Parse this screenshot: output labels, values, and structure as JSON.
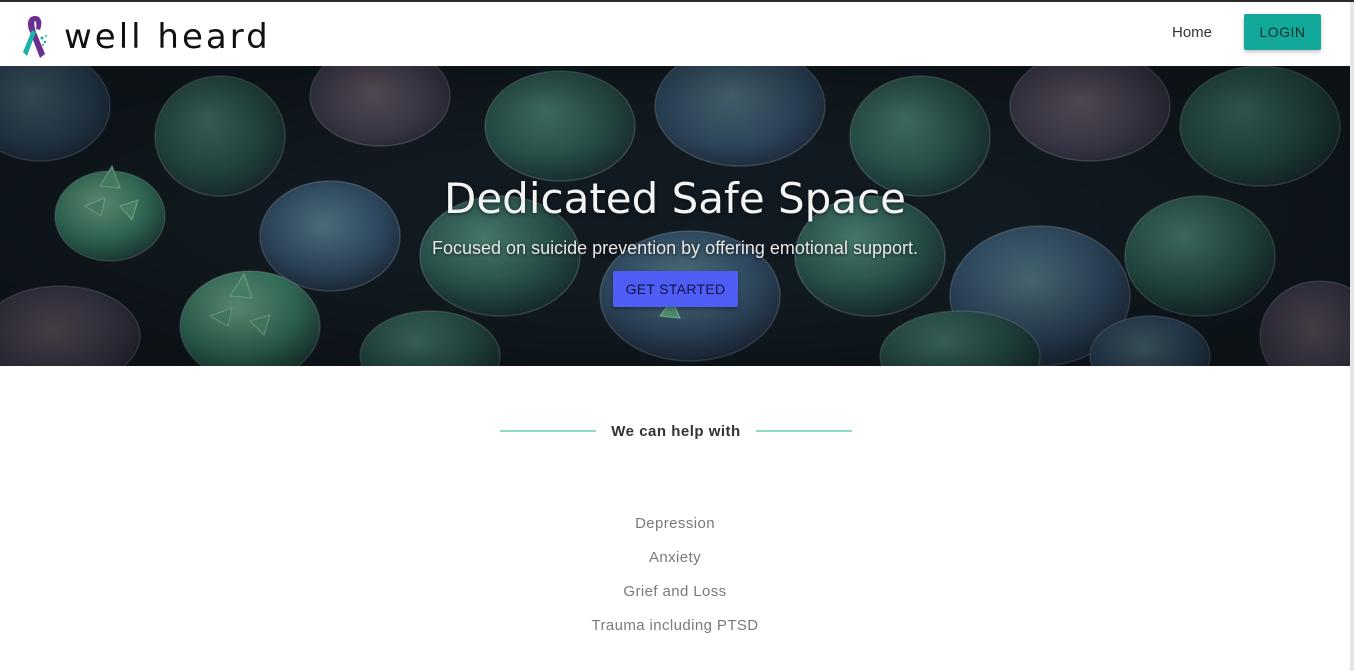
{
  "brand": {
    "name": "well heard",
    "logo_icon": "awareness-ribbon-icon"
  },
  "nav": {
    "home_label": "Home",
    "login_label": "LOGIN"
  },
  "hero": {
    "title": "Dedicated Safe Space",
    "subtitle": "Focused on suicide prevention by offering emotional support.",
    "cta_label": "GET STARTED",
    "background": "succulent-plants-image"
  },
  "help_section": {
    "heading": "We can help with",
    "items": [
      "Depression",
      "Anxiety",
      "Grief and Loss",
      "Trauma including PTSD"
    ]
  },
  "colors": {
    "login_button": "#13a99a",
    "cta_button": "#4e5ef5",
    "heading_rule": "#8fd9c9",
    "ribbon_purple": "#6b2d8f",
    "ribbon_teal": "#1bb3a6"
  }
}
